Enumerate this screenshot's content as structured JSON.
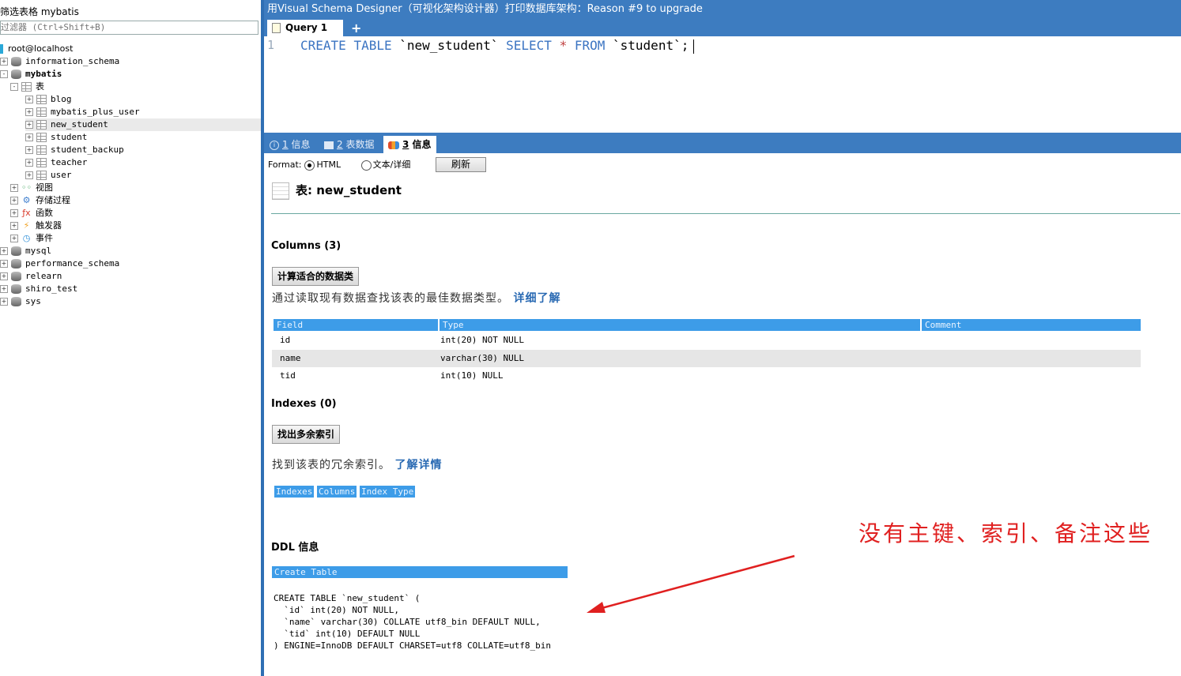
{
  "left_panel": {
    "filter_label": "筛选表格 mybatis",
    "filter_placeholder": "过滤器 (Ctrl+Shift+B)",
    "connection": "root@localhost",
    "tree": [
      {
        "label": "information_schema",
        "level": 0,
        "icon": "database-icon",
        "toggle": "+"
      },
      {
        "label": "mybatis",
        "level": 0,
        "icon": "database-icon",
        "toggle": "-",
        "bold": true
      },
      {
        "label": "表",
        "level": 1,
        "icon": "table-folder-icon",
        "toggle": "-"
      },
      {
        "label": "blog",
        "level": 2,
        "icon": "table-icon",
        "toggle": "+"
      },
      {
        "label": "mybatis_plus_user",
        "level": 2,
        "icon": "table-icon",
        "toggle": "+"
      },
      {
        "label": "new_student",
        "level": 2,
        "icon": "table-icon",
        "toggle": "+",
        "selected": true
      },
      {
        "label": "student",
        "level": 2,
        "icon": "table-icon",
        "toggle": "+"
      },
      {
        "label": "student_backup",
        "level": 2,
        "icon": "table-icon",
        "toggle": "+"
      },
      {
        "label": "teacher",
        "level": 2,
        "icon": "table-icon",
        "toggle": "+"
      },
      {
        "label": "user",
        "level": 2,
        "icon": "table-icon",
        "toggle": "+"
      },
      {
        "label": "视图",
        "level": 1,
        "icon": "view-icon",
        "toggle": "+"
      },
      {
        "label": "存储过程",
        "level": 1,
        "icon": "procedure-icon",
        "toggle": "+"
      },
      {
        "label": "函数",
        "level": 1,
        "icon": "function-icon",
        "toggle": "+"
      },
      {
        "label": "触发器",
        "level": 1,
        "icon": "trigger-icon",
        "toggle": "+"
      },
      {
        "label": "事件",
        "level": 1,
        "icon": "event-icon",
        "toggle": "+"
      },
      {
        "label": "mysql",
        "level": 0,
        "icon": "database-icon",
        "toggle": "+"
      },
      {
        "label": "performance_schema",
        "level": 0,
        "icon": "database-icon",
        "toggle": "+"
      },
      {
        "label": "relearn",
        "level": 0,
        "icon": "database-icon",
        "toggle": "+"
      },
      {
        "label": "shiro_test",
        "level": 0,
        "icon": "database-icon",
        "toggle": "+"
      },
      {
        "label": "sys",
        "level": 0,
        "icon": "database-icon",
        "toggle": "+"
      }
    ]
  },
  "topbar": {
    "message": "用Visual Schema Designer（可视化架构设计器）打印数据库架构：Reason #9 to upgrade"
  },
  "query_tabs": {
    "active_label": "Query 1",
    "plus": "+"
  },
  "editor": {
    "line_number": "1",
    "tokens": {
      "create": "CREATE",
      "table": "TABLE",
      "target": "`new_student`",
      "select": "SELECT",
      "star": "*",
      "from": "FROM",
      "source": "`student`",
      "semi": ";"
    }
  },
  "result_tabs": [
    {
      "num": "1",
      "label": "信息"
    },
    {
      "num": "2",
      "label": "表数据"
    },
    {
      "num": "3",
      "label": "信息",
      "active": true
    }
  ],
  "info": {
    "format_label": "Format:",
    "format_html": "HTML",
    "format_text": "文本/详细",
    "refresh": "刷新",
    "table_title": "表: new_student",
    "columns_heading": "Columns (3)",
    "calc_button": "计算适合的数据类",
    "calc_hint": "通过读取现有数据查找该表的最佳数据类型。",
    "calc_link": "详细了解",
    "columns_headers": [
      "Field",
      "Type",
      "Comment"
    ],
    "columns_rows": [
      {
        "field": "id",
        "type": "int(20) NOT NULL",
        "comment": ""
      },
      {
        "field": "name",
        "type": "varchar(30) NULL",
        "comment": ""
      },
      {
        "field": "tid",
        "type": "int(10) NULL",
        "comment": ""
      }
    ],
    "indexes_heading": "Indexes (0)",
    "index_button": "找出多余索引",
    "index_hint": "找到该表的冗余索引。",
    "index_link": "了解详情",
    "indexes_headers": [
      "Indexes",
      "Columns",
      "Index Type"
    ],
    "ddl_heading": "DDL 信息",
    "ddl_header": "Create Table",
    "ddl_lines": [
      "CREATE TABLE `new_student` (",
      "  `id` int(20) NOT NULL,",
      "  `name` varchar(30) COLLATE utf8_bin DEFAULT NULL,",
      "  `tid` int(10) DEFAULT NULL",
      ") ENGINE=InnoDB DEFAULT CHARSET=utf8 COLLATE=utf8_bin"
    ]
  },
  "annotation": {
    "text": "没有主键、索引、备注这些",
    "color": "#e02020"
  },
  "colors": {
    "accent_blue": "#3d7cc0",
    "header_blue": "#3d9ce8",
    "keyword_blue": "#3b74c2"
  }
}
